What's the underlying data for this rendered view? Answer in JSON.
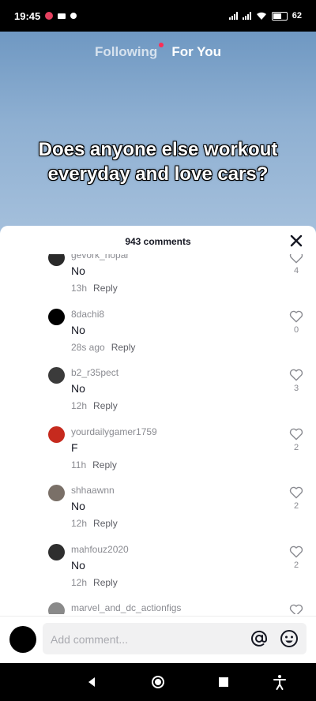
{
  "status_bar": {
    "time": "19:45",
    "battery_percent": "62"
  },
  "feed": {
    "tab_following": "Following",
    "tab_for_you": "For You",
    "caption_line1": "Does anyone else workout",
    "caption_line2": "everyday and love cars?"
  },
  "comments_panel": {
    "count_label": "943 comments",
    "comments": [
      {
        "username": "gevork_hopar",
        "text": "No",
        "time": "13h",
        "reply": "Reply",
        "likes": "4",
        "avatar_color": "#2a2a2a"
      },
      {
        "username": "8dachi8",
        "text": "No",
        "time": "28s ago",
        "reply": "Reply",
        "likes": "0",
        "avatar_color": "#000000"
      },
      {
        "username": "b2_r35pect",
        "text": "No",
        "time": "12h",
        "reply": "Reply",
        "likes": "3",
        "avatar_color": "#3b3b3b"
      },
      {
        "username": "yourdailygamer1759",
        "text": "F",
        "time": "11h",
        "reply": "Reply",
        "likes": "2",
        "avatar_color": "#c62a1e"
      },
      {
        "username": "shhaawnn",
        "text": "No",
        "time": "12h",
        "reply": "Reply",
        "likes": "2",
        "avatar_color": "#7a7068"
      },
      {
        "username": "mahfouz2020",
        "text": "No",
        "time": "12h",
        "reply": "Reply",
        "likes": "2",
        "avatar_color": "#2e2e2e"
      },
      {
        "username": "marvel_and_dc_actionfigs",
        "text": "",
        "time": "",
        "reply": "",
        "likes": "",
        "avatar_color": "#8a8a8a"
      }
    ]
  },
  "input": {
    "placeholder": "Add comment..."
  },
  "colors": {
    "accent": "#fe2c55",
    "secondary_text": "#8a8b91"
  }
}
